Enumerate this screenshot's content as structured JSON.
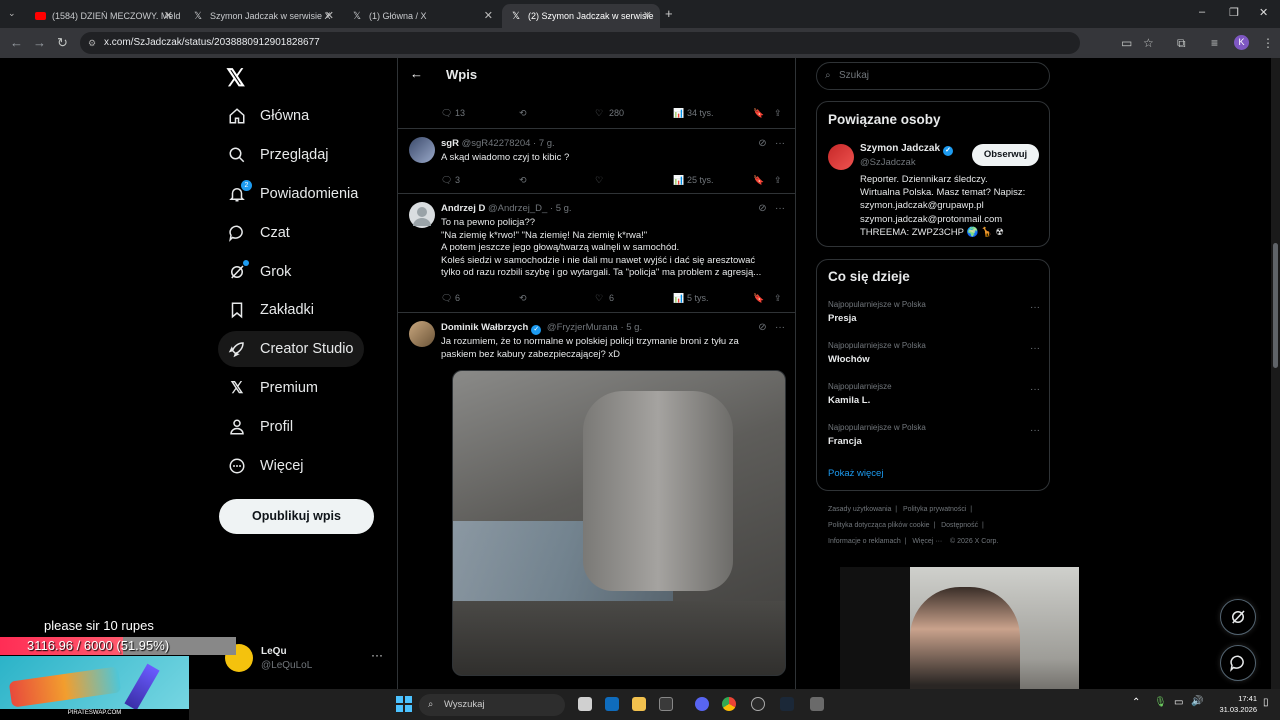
{
  "browser": {
    "tabs": [
      {
        "title": "(1584) DZIEŃ MECZOWY. Meld",
        "icon": "youtube-icon",
        "active": false
      },
      {
        "title": "Szymon Jadczak w serwisie X",
        "icon": "x-logo-icon",
        "active": false
      },
      {
        "title": "(1) Główna / X",
        "icon": "x-logo-icon",
        "active": false
      },
      {
        "title": "(2) Szymon Jadczak w serwisie",
        "icon": "x-logo-icon",
        "active": true
      }
    ],
    "url": "x.com/SzJadczak/status/2038880912901828677",
    "profile_initial": "K"
  },
  "nav": {
    "items": [
      {
        "label": "Główna",
        "icon": "home-icon"
      },
      {
        "label": "Przeglądaj",
        "icon": "search-icon"
      },
      {
        "label": "Powiadomienia",
        "icon": "bell-icon",
        "badge": "2"
      },
      {
        "label": "Czat",
        "icon": "chat-icon"
      },
      {
        "label": "Grok",
        "icon": "grok-icon"
      },
      {
        "label": "Zakładki",
        "icon": "bookmark-icon"
      },
      {
        "label": "Creator Studio",
        "icon": "rocket-icon"
      },
      {
        "label": "Premium",
        "icon": "x-logo-icon"
      },
      {
        "label": "Profil",
        "icon": "person-icon"
      },
      {
        "label": "Więcej",
        "icon": "more-circle-icon"
      }
    ],
    "post_button": "Opublikuj wpis",
    "account": {
      "name": "LeQu",
      "handle": "@LeQuLoL"
    }
  },
  "main": {
    "header_title": "Wpis",
    "top_actions": {
      "replies": "13",
      "likes": "280",
      "views": "34 tys."
    },
    "tweets": [
      {
        "name": "sgR",
        "handle": "@sgR42278204",
        "time": "· 7 g.",
        "verified": false,
        "text": [
          "A skąd wiadomo czyj to kibic ?"
        ],
        "replies": "3",
        "likes": "",
        "views": "25 tys."
      },
      {
        "name": "Andrzej D",
        "handle": "@Andrzej_D_",
        "time": "· 5 g.",
        "verified": false,
        "text": [
          "To na pewno policja??",
          "\"Na ziemię k*rwo!\" \"Na ziemię! Na ziemię k*rwa!\"",
          "A potem jeszcze jego głową/twarzą walnęli w samochód.",
          "Koleś siedzi w samochodzie i nie dali mu nawet wyjść i dać się aresztować",
          "tylko od razu rozbili szybę i go wytargali. Ta \"policja\" ma problem z agresją..."
        ],
        "replies": "6",
        "likes": "6",
        "views": "5 tys."
      },
      {
        "name": "Dominik Wałbrzych",
        "handle": "@FryzjerMurana",
        "time": "· 5 g.",
        "verified": true,
        "text": [
          "Ja rozumiem, że to normalne w polskiej policji trzymanie broni z tyłu za",
          "paskiem bez kabury zabezpieczającej? xD"
        ]
      }
    ]
  },
  "right": {
    "search_placeholder": "Szukaj",
    "related": {
      "title": "Powiązane osoby",
      "person": {
        "name": "Szymon Jadczak",
        "handle": "@SzJadczak",
        "follow": "Obserwuj",
        "bio": [
          "Reporter. Dziennikarz śledczy.",
          "Wirtualna Polska. Masz temat? Napisz:",
          "szymon.jadczak@grupawp.pl",
          "szymon.jadczak@protonmail.com",
          "THREEMA: ZWPZ3CHP 🌍 🦒 ☢"
        ]
      }
    },
    "trending": {
      "title": "Co się dzieje",
      "items": [
        {
          "context": "Najpopularniejsze w Polska",
          "name": "Presja"
        },
        {
          "context": "Najpopularniejsze w Polska",
          "name": "Włochów"
        },
        {
          "context": "Najpopularniejsze",
          "name": "Kamila L."
        },
        {
          "context": "Najpopularniejsze w Polska",
          "name": "Francja"
        }
      ],
      "show_more": "Pokaż więcej"
    },
    "footer": [
      [
        "Zasady użytkowania",
        "Polityka prywatności"
      ],
      [
        "Polityka dotycząca plików cookie",
        "Dostępność"
      ],
      [
        "Informacje o reklamach",
        "Więcej ···",
        "© 2026 X Corp."
      ]
    ]
  },
  "stream": {
    "donation_message": "please sir 10 rupes",
    "goal_text": "3116.96 / 6000 (51.95%)",
    "goal_fraction": 0.5195,
    "sponsor_text": "PIRATESWAP.COM"
  },
  "taskbar": {
    "search_placeholder": "Wyszukaj",
    "time": "17:41",
    "date": "31.03.2026"
  },
  "colors": {
    "accent": "#1d9bf0",
    "background": "#000000",
    "border": "#2f3336",
    "muted": "#71767b"
  }
}
